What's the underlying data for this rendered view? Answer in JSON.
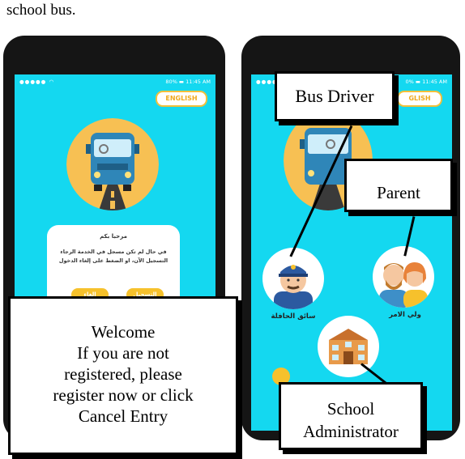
{
  "caption": "school bus.",
  "status_bar": {
    "left": "●●●●● ",
    "right": "80% ▬ 11:45 AM",
    "right_partial": "0% ▬ 11:45 AM"
  },
  "language_button": "ENGLISH",
  "language_button_partial": "GLISH",
  "welcome_dialog": {
    "title": "مرحبا بكم",
    "body": "في حال لم تكن مسجل في الخدمة الرجاء التسجيل الآن، او الضغط على إلغاء الدخول",
    "register_button": "التسجيل",
    "cancel_button": "إلغاء"
  },
  "roles": {
    "driver_label": "سائق الحافلة",
    "parent_label": "ولي الامر"
  },
  "annotations": {
    "welcome_lines": [
      "Welcome",
      "If you are not",
      "registered, please",
      "register now or click",
      "Cancel Entry"
    ],
    "bus_driver": "Bus Driver",
    "parent": "Parent",
    "school_admin_lines": [
      "School",
      "Administrator"
    ]
  },
  "colors": {
    "screen_bg": "#14d8f0",
    "accent_yellow": "#f6c12c",
    "phone_frame": "#151515"
  }
}
